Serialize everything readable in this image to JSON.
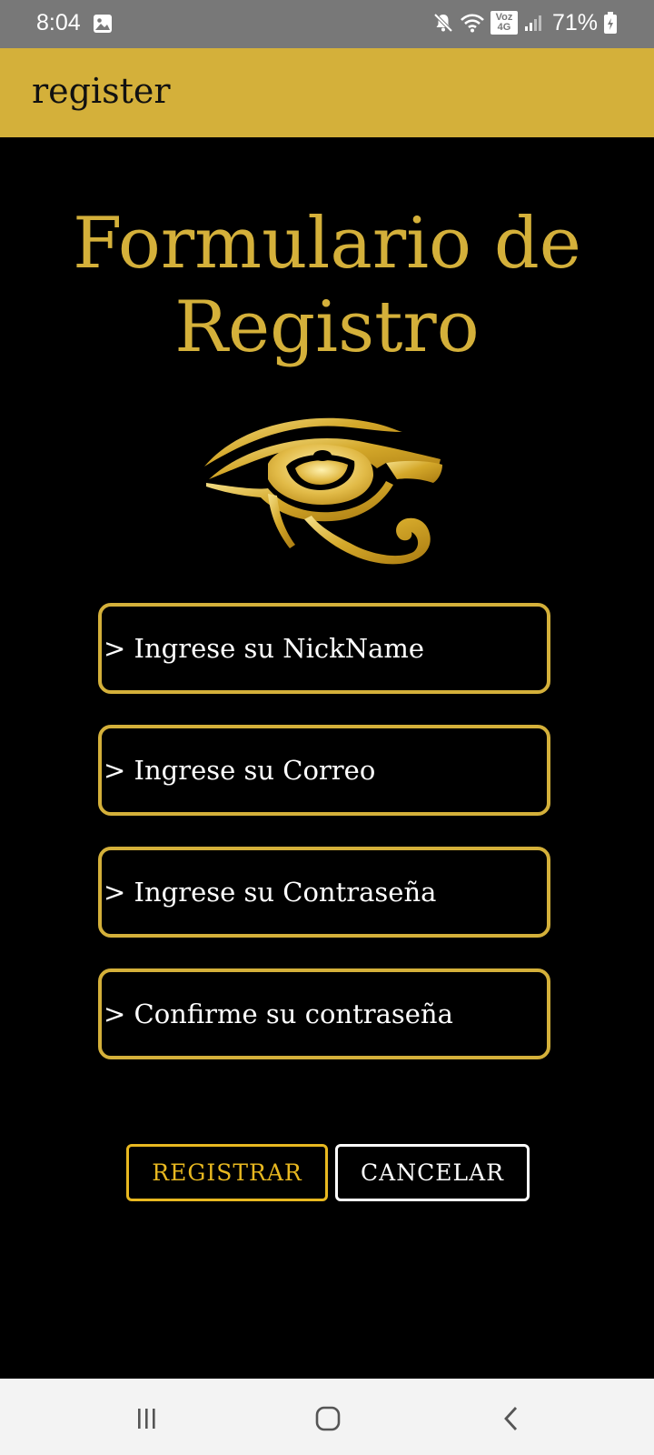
{
  "status_bar": {
    "time": "8:04",
    "network_label": "Voz 4G",
    "battery_percent": "71%",
    "icons": [
      "gallery-icon",
      "mute-icon",
      "wifi-icon",
      "volte-4g-icon",
      "signal-icon",
      "battery-icon"
    ]
  },
  "app_bar": {
    "title": "register"
  },
  "form": {
    "title_line1": "Formulario de",
    "title_line2": "Registro",
    "logo": "eye-of-horus-logo",
    "fields": [
      {
        "placeholder": "> Ingrese su NickName",
        "value": ""
      },
      {
        "placeholder": "> Ingrese su Correo",
        "value": ""
      },
      {
        "placeholder": "> Ingrese su Contraseña",
        "value": ""
      },
      {
        "placeholder": "> Confirme su contraseña",
        "value": ""
      }
    ],
    "register_label": "REGISTRAR",
    "cancel_label": "CANCELAR"
  },
  "nav_bar": {
    "icons": [
      "recents-icon",
      "home-icon",
      "back-icon"
    ]
  },
  "colors": {
    "accent_gold": "#d4b03a",
    "register_gold": "#e8b820",
    "background": "#000000",
    "status_bar": "#787878"
  }
}
